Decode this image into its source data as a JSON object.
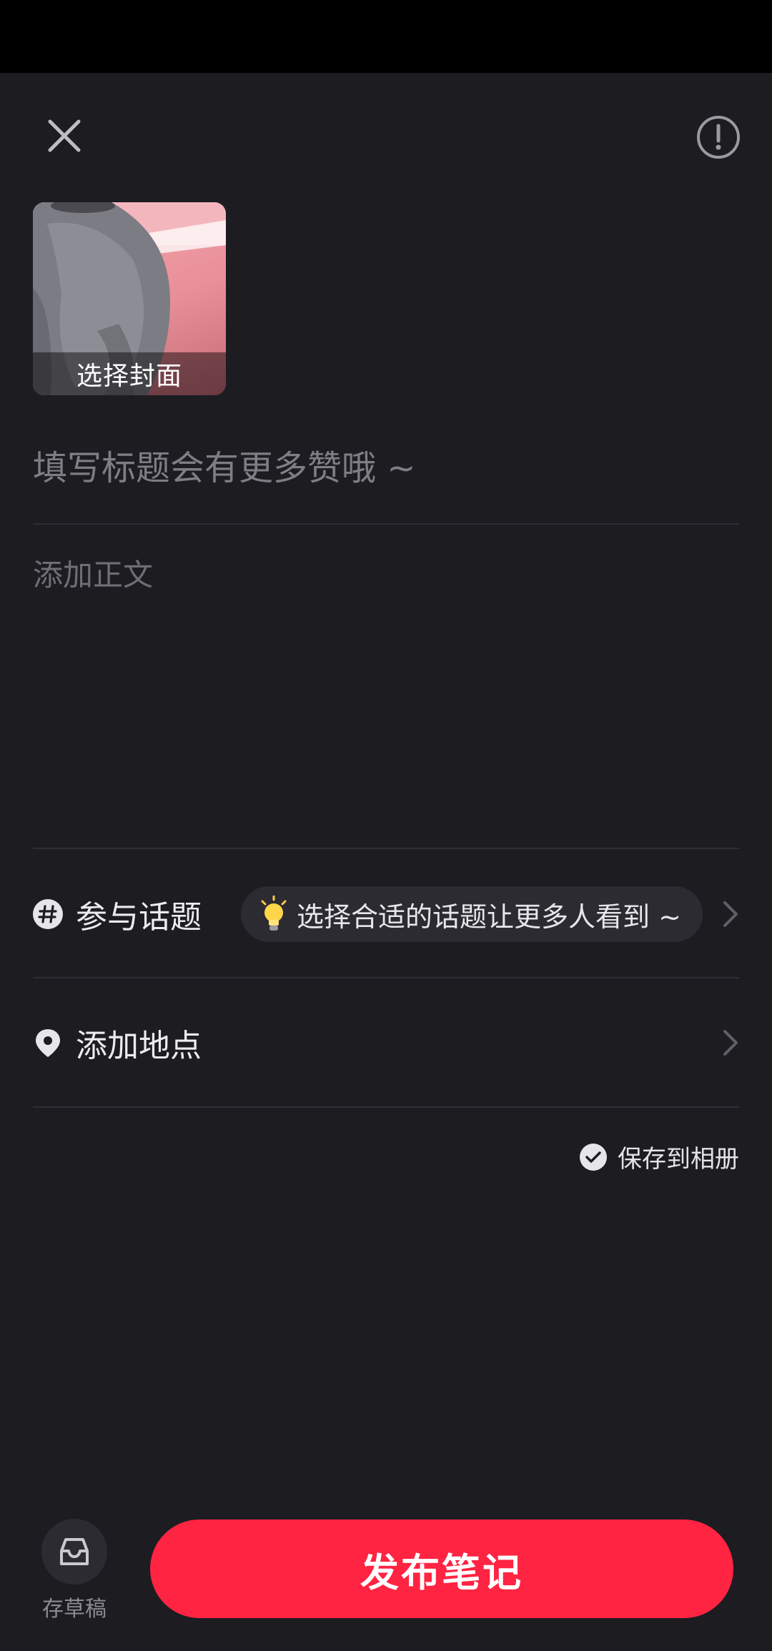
{
  "header": {
    "close_icon": "close-icon",
    "info_icon": "exclamation-circle-icon"
  },
  "cover": {
    "label": "选择封面"
  },
  "note": {
    "title_placeholder": "填写标题会有更多赞哦 ~",
    "body_placeholder": "添加正文"
  },
  "topic": {
    "icon": "hashtag-icon",
    "label": "参与话题",
    "suggestion_icon": "lightbulb-icon",
    "suggestion_text": "选择合适的话题让更多人看到 ~"
  },
  "location": {
    "icon": "location-pin-icon",
    "label": "添加地点"
  },
  "save_album": {
    "label": "保存到相册",
    "checked": true
  },
  "footer": {
    "draft_label": "存草稿",
    "publish_label": "发布笔记"
  },
  "colors": {
    "background": "#1c1c21",
    "accent": "#ff2442",
    "divider": "#2e2e35"
  }
}
